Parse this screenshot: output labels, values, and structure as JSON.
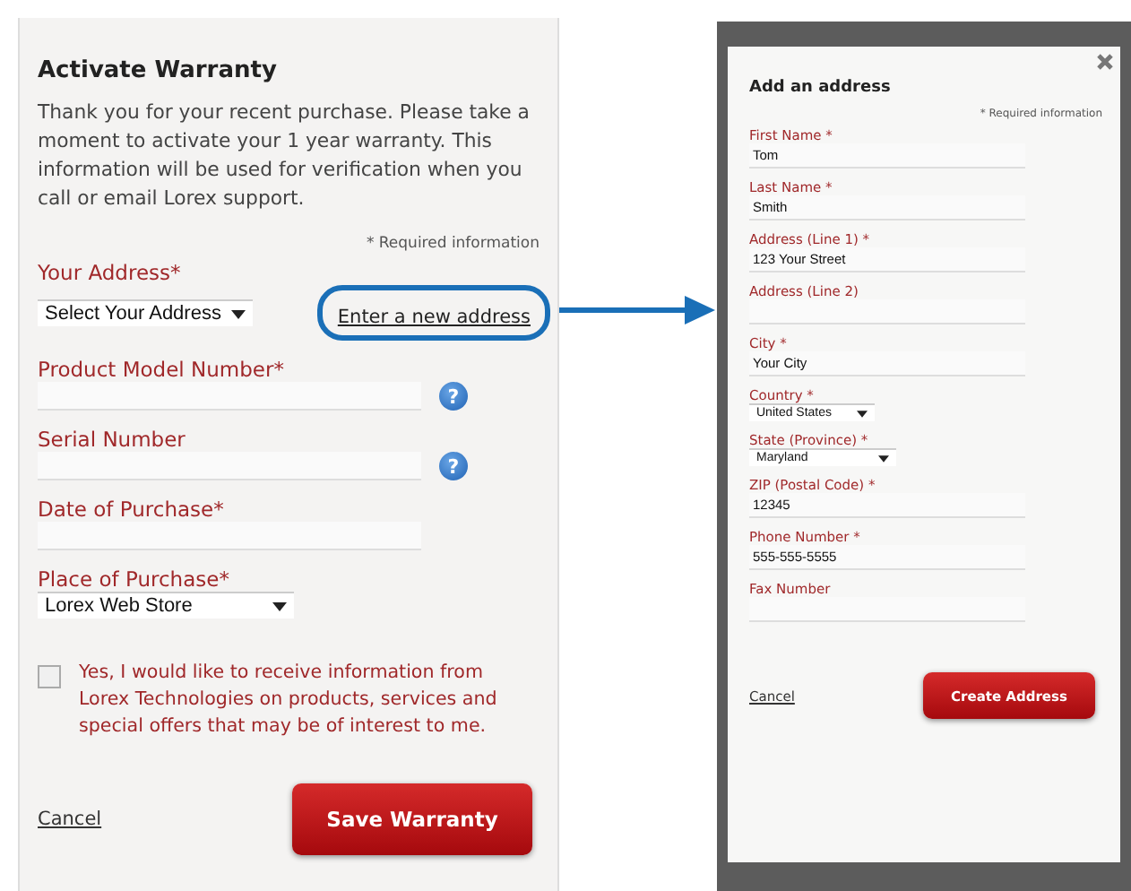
{
  "warranty": {
    "title": "Activate Warranty",
    "intro": "Thank you for your recent purchase. Please take a moment to activate your 1 year warranty. This information will be used for verification when you call or email Lorex support.",
    "required_note": "* Required information",
    "fields": [
      {
        "kind": "select",
        "label": "Your Address*",
        "value": "Select Your Address",
        "link": "Enter a new address"
      },
      {
        "kind": "input",
        "label": "Product Model Number*",
        "help": "?"
      },
      {
        "kind": "input",
        "label": "Serial Number",
        "help": "?"
      },
      {
        "kind": "input",
        "label": "Date of Purchase*"
      },
      {
        "kind": "select",
        "label": "Place of Purchase*",
        "value": "Lorex Web Store"
      }
    ],
    "opt_in": {
      "label": "Yes, I would like to receive information from Lorex Technologies on products, services and special offers that may be of interest to me.",
      "checked": false
    },
    "cancel": "Cancel",
    "submit": "Save Warranty"
  },
  "address_dialog": {
    "title": "Add an address",
    "required_note": "* Required information",
    "fields": [
      {
        "kind": "input",
        "label": "First Name *",
        "value": "Tom"
      },
      {
        "kind": "input",
        "label": "Last Name *",
        "value": "Smith"
      },
      {
        "kind": "input",
        "label": "Address (Line 1) *",
        "value": "123 Your Street"
      },
      {
        "kind": "input",
        "label": "Address (Line 2)"
      },
      {
        "kind": "input",
        "label": "City *",
        "value": "Your City"
      },
      {
        "kind": "select",
        "label": "Country *",
        "value": "United States"
      },
      {
        "kind": "select",
        "label": "State (Province) *",
        "value": "Maryland"
      },
      {
        "kind": "input",
        "label": "ZIP (Postal Code) *",
        "value": "12345"
      },
      {
        "kind": "input",
        "label": "Phone Number *",
        "value": "555-555-5555"
      },
      {
        "kind": "input",
        "label": "Fax Number"
      }
    ],
    "cancel": "Cancel",
    "submit": "Create Address"
  }
}
